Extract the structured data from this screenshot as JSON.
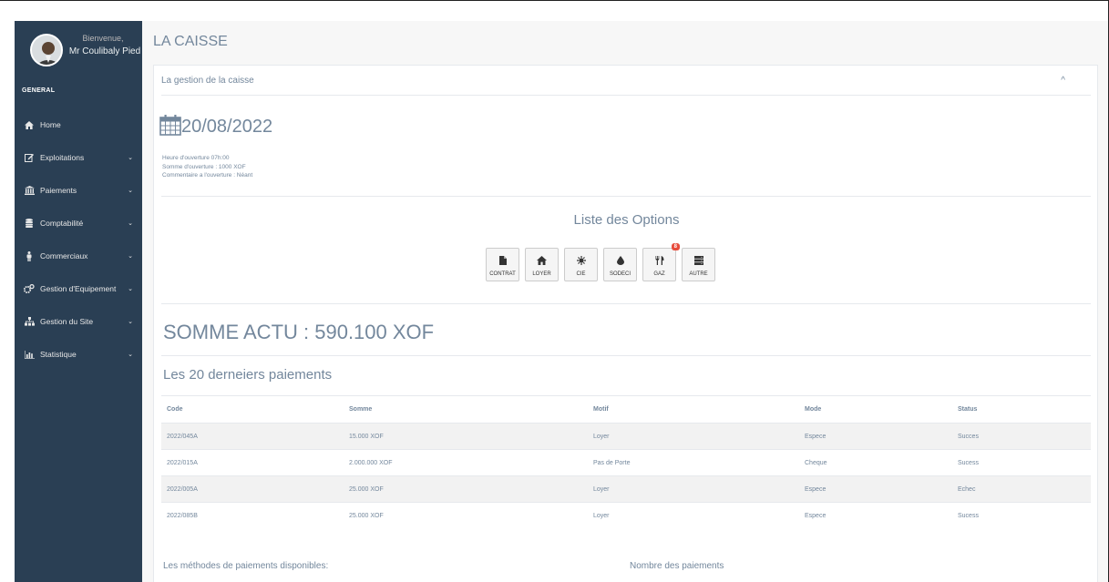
{
  "sidebar": {
    "welcome": "Bienvenue,",
    "username": "Mr Coulibaly Pied",
    "section": "GENERAL",
    "items": [
      {
        "label": "Home",
        "icon": "home-icon",
        "has_submenu": false
      },
      {
        "label": "Exploitations",
        "icon": "edit-icon",
        "has_submenu": true
      },
      {
        "label": "Paiements",
        "icon": "bank-icon",
        "has_submenu": true
      },
      {
        "label": "Comptabilité",
        "icon": "database-icon",
        "has_submenu": true
      },
      {
        "label": "Commerciaux",
        "icon": "male-icon",
        "has_submenu": true
      },
      {
        "label": "Gestion d'Equipement",
        "icon": "cogs-icon",
        "has_submenu": true
      },
      {
        "label": "Gestion du Site",
        "icon": "sitemap-icon",
        "has_submenu": true
      },
      {
        "label": "Statistique",
        "icon": "bar-chart-icon",
        "has_submenu": true
      }
    ],
    "chevron": "⌄"
  },
  "page": {
    "title": "LA CAISSE"
  },
  "panel": {
    "header": "La gestion de la caisse",
    "collapse_glyph": "^",
    "date": "20/08/2022",
    "info": [
      "Heure d'ouverture 07h:00",
      "Somme d'ouverture : 1000 XOF",
      "Commentaire a l'ouverture : Néant"
    ],
    "options_title": "Liste des Options",
    "options": [
      {
        "label": "CONTRAT",
        "icon": "file-icon"
      },
      {
        "label": "LOYER",
        "icon": "home-icon"
      },
      {
        "label": "CIE",
        "icon": "sun-icon"
      },
      {
        "label": "SODECI",
        "icon": "drop-icon"
      },
      {
        "label": "GAZ",
        "icon": "cutlery-icon",
        "badge": "8"
      },
      {
        "label": "AUTRE",
        "icon": "server-icon"
      }
    ],
    "somme": "SOMME ACTU : 590.100 XOF",
    "payments_title": "Les 20 derneiers paiements",
    "table": {
      "headers": [
        "Code",
        "Somme",
        "Motif",
        "Mode",
        "Status"
      ],
      "rows": [
        [
          "2022/045A",
          "15.000 XOF",
          "Loyer",
          "Espece",
          "Succes"
        ],
        [
          "2022/015A",
          "2.000.000 XOF",
          "Pas de Porte",
          "Cheque",
          "Sucess"
        ],
        [
          "2022/005A",
          "25.000 XOF",
          "Loyer",
          "Espece",
          "Echec"
        ],
        [
          "2022/085B",
          "25.000 XOF",
          "Loyer",
          "Espece",
          "Sucess"
        ]
      ]
    },
    "bottom_left": "Les méthodes de paiements disponibles:",
    "bottom_right": "Nombre des paiements"
  },
  "colors": {
    "sidebar_bg": "#2a3f54",
    "main_bg": "#f7f7f7",
    "text": "#73879c",
    "badge": "#e74c3c"
  }
}
